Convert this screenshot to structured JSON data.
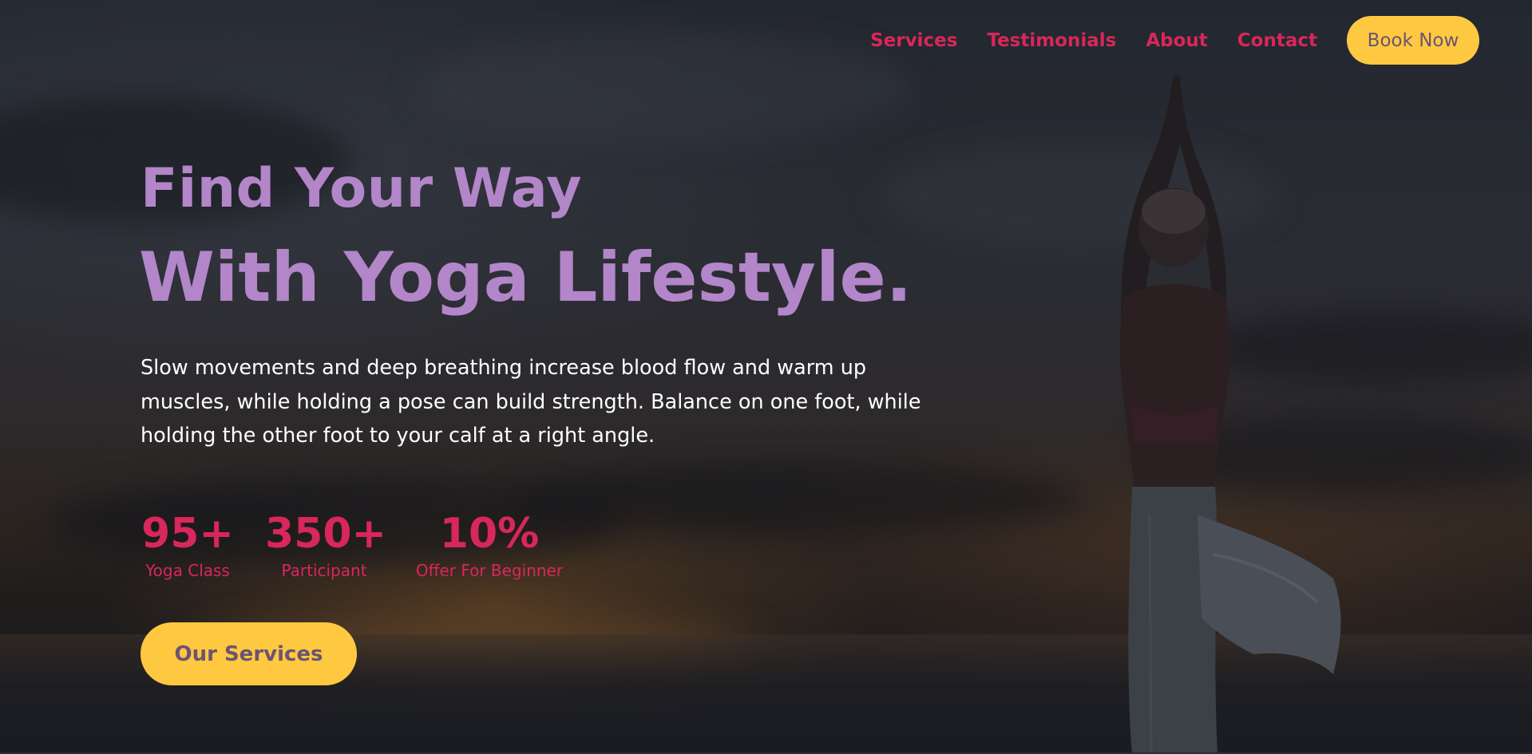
{
  "nav": {
    "links": [
      {
        "label": "Services"
      },
      {
        "label": "Testimonials"
      },
      {
        "label": "About"
      },
      {
        "label": "Contact"
      }
    ],
    "book_button": "Book Now"
  },
  "hero": {
    "title_line1": "Find Your Way",
    "title_line2": "With Yoga Lifestyle.",
    "description": "Slow movements and deep breathing increase blood flow and warm up muscles, while holding a pose can build strength. Balance on one foot, while holding the other foot to your calf at a right angle.",
    "stats": [
      {
        "value": "95+",
        "label": "Yoga Class"
      },
      {
        "value": "350+",
        "label": "Participant"
      },
      {
        "value": "10%",
        "label": "Offer For Beginner"
      }
    ],
    "cta_button": "Our Services"
  },
  "colors": {
    "accent_pink": "#d8275a",
    "heading_purple": "#b286c8",
    "button_yellow": "#fec841",
    "button_text": "#6c5472",
    "background_dark": "#23272f"
  },
  "background_image": "yoga-silhouette-sunset"
}
